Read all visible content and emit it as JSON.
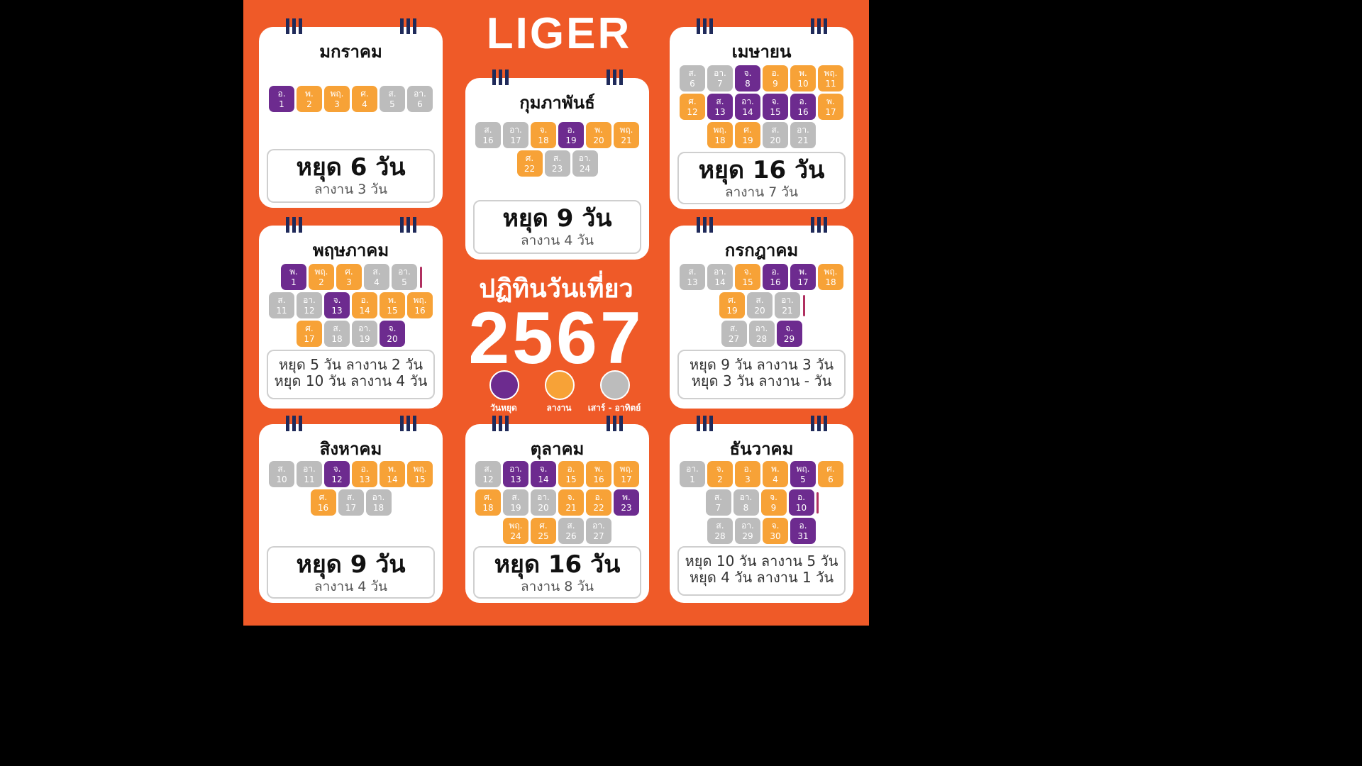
{
  "brand": "LIGER",
  "title": "ปฏิทินวันเที่ยว",
  "year": "2567",
  "legend": [
    {
      "label": "วันหยุด",
      "color": "#6d2b8f"
    },
    {
      "label": "ลางาน",
      "color": "#f7a237"
    },
    {
      "label": "เสาร์ - อาทิตย์",
      "color": "#bcbcbc"
    }
  ],
  "months": {
    "jan": {
      "name": "มกราคม",
      "summary": {
        "big": "หยุด 6 วัน",
        "small": "ลางาน 3 วัน"
      },
      "rows": [
        [
          [
            "อ.",
            "1",
            "h"
          ],
          [
            "พ.",
            "2",
            "l"
          ],
          [
            "พฤ.",
            "3",
            "l"
          ],
          [
            "ศ.",
            "4",
            "l"
          ],
          [
            "ส.",
            "5",
            "w"
          ],
          [
            "อา.",
            "6",
            "w"
          ]
        ]
      ]
    },
    "feb": {
      "name": "กุมภาพันธ์",
      "summary": {
        "big": "หยุด 9 วัน",
        "small": "ลางาน 4 วัน"
      },
      "rows": [
        [
          [
            "ส.",
            "16",
            "w"
          ],
          [
            "อา.",
            "17",
            "w"
          ],
          [
            "จ.",
            "18",
            "l"
          ],
          [
            "อ.",
            "19",
            "h"
          ],
          [
            "พ.",
            "20",
            "l"
          ],
          [
            "พฤ.",
            "21",
            "l"
          ]
        ],
        [
          [
            "ศ.",
            "22",
            "l"
          ],
          [
            "ส.",
            "23",
            "w"
          ],
          [
            "อา.",
            "24",
            "w"
          ]
        ]
      ]
    },
    "apr": {
      "name": "เมษายน",
      "summary": {
        "big": "หยุด 16 วัน",
        "small": "ลางาน 7 วัน"
      },
      "rows": [
        [
          [
            "ส.",
            "6",
            "w"
          ],
          [
            "อา.",
            "7",
            "w"
          ],
          [
            "จ.",
            "8",
            "h"
          ],
          [
            "อ.",
            "9",
            "l"
          ],
          [
            "พ.",
            "10",
            "l"
          ],
          [
            "พฤ.",
            "11",
            "l"
          ]
        ],
        [
          [
            "ศ.",
            "12",
            "l"
          ],
          [
            "ส.",
            "13",
            "h"
          ],
          [
            "อา.",
            "14",
            "h"
          ],
          [
            "จ.",
            "15",
            "h"
          ],
          [
            "อ.",
            "16",
            "h"
          ],
          [
            "พ.",
            "17",
            "l"
          ]
        ],
        [
          [
            "พฤ.",
            "18",
            "l"
          ],
          [
            "ศ.",
            "19",
            "l"
          ],
          [
            "ส.",
            "20",
            "w"
          ],
          [
            "อา.",
            "21",
            "w"
          ]
        ]
      ]
    },
    "may": {
      "name": "พฤษภาคม",
      "summary": {
        "line1": "หยุด 5 วัน ลางาน 2 วัน",
        "line2": "หยุด 10 วัน ลางาน 4 วัน"
      },
      "rows": [
        [
          [
            "พ.",
            "1",
            "h"
          ],
          [
            "พฤ.",
            "2",
            "l"
          ],
          [
            "ศ.",
            "3",
            "l"
          ],
          [
            "ส.",
            "4",
            "w"
          ],
          [
            "อา.",
            "5",
            "w"
          ],
          [
            "|",
            "",
            "s"
          ]
        ],
        [
          [
            "ส.",
            "11",
            "w"
          ],
          [
            "อา.",
            "12",
            "w"
          ],
          [
            "จ.",
            "13",
            "h"
          ],
          [
            "อ.",
            "14",
            "l"
          ],
          [
            "พ.",
            "15",
            "l"
          ],
          [
            "พฤ.",
            "16",
            "l"
          ]
        ],
        [
          [
            "ศ.",
            "17",
            "l"
          ],
          [
            "ส.",
            "18",
            "w"
          ],
          [
            "อา.",
            "19",
            "w"
          ],
          [
            "จ.",
            "20",
            "h"
          ]
        ]
      ]
    },
    "jul": {
      "name": "กรกฎาคม",
      "summary": {
        "line1": "หยุด 9 วัน ลางาน 3 วัน",
        "line2": "หยุด 3 วัน ลางาน - วัน"
      },
      "rows": [
        [
          [
            "ส.",
            "13",
            "w"
          ],
          [
            "อา.",
            "14",
            "w"
          ],
          [
            "จ.",
            "15",
            "l"
          ],
          [
            "อ.",
            "16",
            "h"
          ],
          [
            "พ.",
            "17",
            "h"
          ],
          [
            "พฤ.",
            "18",
            "l"
          ]
        ],
        [
          [
            "ศ.",
            "19",
            "l"
          ],
          [
            "ส.",
            "20",
            "w"
          ],
          [
            "อา.",
            "21",
            "w"
          ],
          [
            "|",
            "",
            "s"
          ]
        ],
        [
          [
            "ส.",
            "27",
            "w"
          ],
          [
            "อา.",
            "28",
            "w"
          ],
          [
            "จ.",
            "29",
            "h"
          ]
        ]
      ]
    },
    "aug": {
      "name": "สิงหาคม",
      "summary": {
        "big": "หยุด 9 วัน",
        "small": "ลางาน 4 วัน"
      },
      "rows": [
        [
          [
            "ส.",
            "10",
            "w"
          ],
          [
            "อา.",
            "11",
            "w"
          ],
          [
            "จ.",
            "12",
            "h"
          ],
          [
            "อ.",
            "13",
            "l"
          ],
          [
            "พ.",
            "14",
            "l"
          ],
          [
            "พฤ.",
            "15",
            "l"
          ]
        ],
        [
          [
            "ศ.",
            "16",
            "l"
          ],
          [
            "ส.",
            "17",
            "w"
          ],
          [
            "อา.",
            "18",
            "w"
          ]
        ]
      ]
    },
    "oct": {
      "name": "ตุลาคม",
      "summary": {
        "big": "หยุด 16 วัน",
        "small": "ลางาน 8 วัน"
      },
      "rows": [
        [
          [
            "ส.",
            "12",
            "w"
          ],
          [
            "อา.",
            "13",
            "h"
          ],
          [
            "จ.",
            "14",
            "h"
          ],
          [
            "อ.",
            "15",
            "l"
          ],
          [
            "พ.",
            "16",
            "l"
          ],
          [
            "พฤ.",
            "17",
            "l"
          ]
        ],
        [
          [
            "ศ.",
            "18",
            "l"
          ],
          [
            "ส.",
            "19",
            "w"
          ],
          [
            "อา.",
            "20",
            "w"
          ],
          [
            "จ.",
            "21",
            "l"
          ],
          [
            "อ.",
            "22",
            "l"
          ],
          [
            "พ.",
            "23",
            "h"
          ]
        ],
        [
          [
            "พฤ.",
            "24",
            "l"
          ],
          [
            "ศ.",
            "25",
            "l"
          ],
          [
            "ส.",
            "26",
            "w"
          ],
          [
            "อา.",
            "27",
            "w"
          ]
        ]
      ]
    },
    "dec": {
      "name": "ธันวาคม",
      "summary": {
        "line1": "หยุด 10 วัน ลางาน 5 วัน",
        "line2": "หยุด 4 วัน ลางาน 1 วัน"
      },
      "rows": [
        [
          [
            "อา.",
            "1",
            "w"
          ],
          [
            "จ.",
            "2",
            "l"
          ],
          [
            "อ.",
            "3",
            "l"
          ],
          [
            "พ.",
            "4",
            "l"
          ],
          [
            "พฤ.",
            "5",
            "h"
          ],
          [
            "ศ.",
            "6",
            "l"
          ]
        ],
        [
          [
            "ส.",
            "7",
            "w"
          ],
          [
            "อา.",
            "8",
            "w"
          ],
          [
            "จ.",
            "9",
            "l"
          ],
          [
            "อ.",
            "10",
            "h"
          ],
          [
            "|",
            "",
            "s"
          ]
        ],
        [
          [
            "ส.",
            "28",
            "w"
          ],
          [
            "อา.",
            "29",
            "w"
          ],
          [
            "จ.",
            "30",
            "l"
          ],
          [
            "อ.",
            "31",
            "h"
          ]
        ]
      ]
    }
  }
}
